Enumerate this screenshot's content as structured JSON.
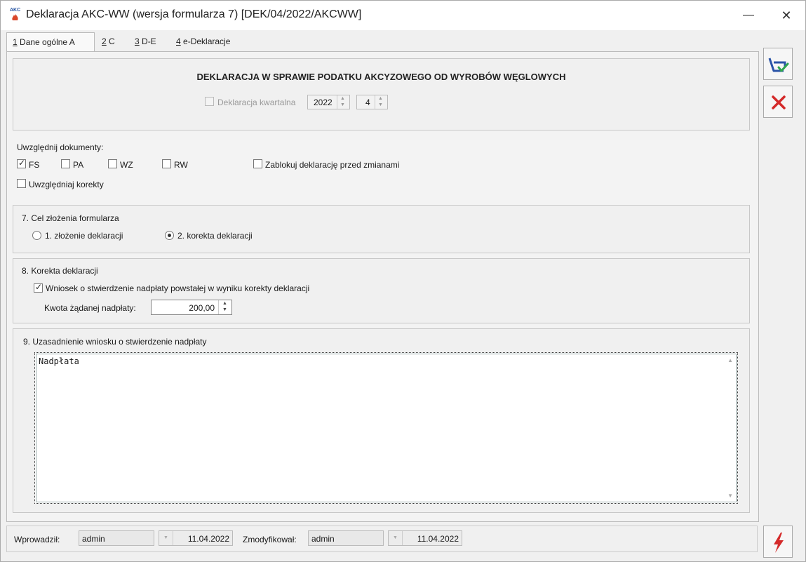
{
  "window": {
    "title": "Deklaracja AKC-WW (wersja formularza 7) [DEK/04/2022/AKCWW]",
    "icon_text": "AKC",
    "minimize": "—",
    "close": "✕"
  },
  "tabs": [
    {
      "key": "1",
      "label": " Dane ogólne A"
    },
    {
      "key": "2",
      "label": " C"
    },
    {
      "key": "3",
      "label": " D-E"
    },
    {
      "key": "4",
      "label": " e-Deklaracje"
    }
  ],
  "header": {
    "title": "DEKLARACJA W SPRAWIE PODATKU AKCYZOWEGO OD WYROBÓW WĘGLOWYCH",
    "quarterly_label": "Deklaracja kwartalna",
    "quarterly_checked": false,
    "year": "2022",
    "month": "4"
  },
  "documents": {
    "label": "Uwzględnij dokumenty:",
    "fs": "FS",
    "fs_checked": true,
    "pa": "PA",
    "pa_checked": false,
    "wz": "WZ",
    "wz_checked": false,
    "rw": "RW",
    "rw_checked": false,
    "lock": "Zablokuj deklarację przed zmianami",
    "lock_checked": false,
    "corrections": "Uwzględniaj korekty",
    "corrections_checked": false
  },
  "section7": {
    "title": "7. Cel złożenia formularza",
    "opt1": "1. złożenie deklaracji",
    "opt2": "2. korekta deklaracji",
    "selected": 2
  },
  "section8": {
    "title": "8. Korekta deklaracji",
    "request": "Wniosek o stwierdzenie nadpłaty powstałej w wyniku korekty deklaracji",
    "request_checked": true,
    "amount_label": "Kwota żądanej nadpłaty:",
    "amount": "200,00"
  },
  "section9": {
    "title": "9. Uzasadnienie wniosku o stwierdzenie nadpłaty",
    "text": "Nadpłata"
  },
  "footer": {
    "entered_label": "Wprowadził:",
    "entered_by": "admin",
    "entered_date": "11.04.2022",
    "modified_label": "Zmodyfikował:",
    "modified_by": "admin",
    "modified_date": "11.04.2022"
  },
  "icons": {
    "save": "save-icon",
    "cancel": "cancel-icon",
    "action": "lightning-icon"
  }
}
